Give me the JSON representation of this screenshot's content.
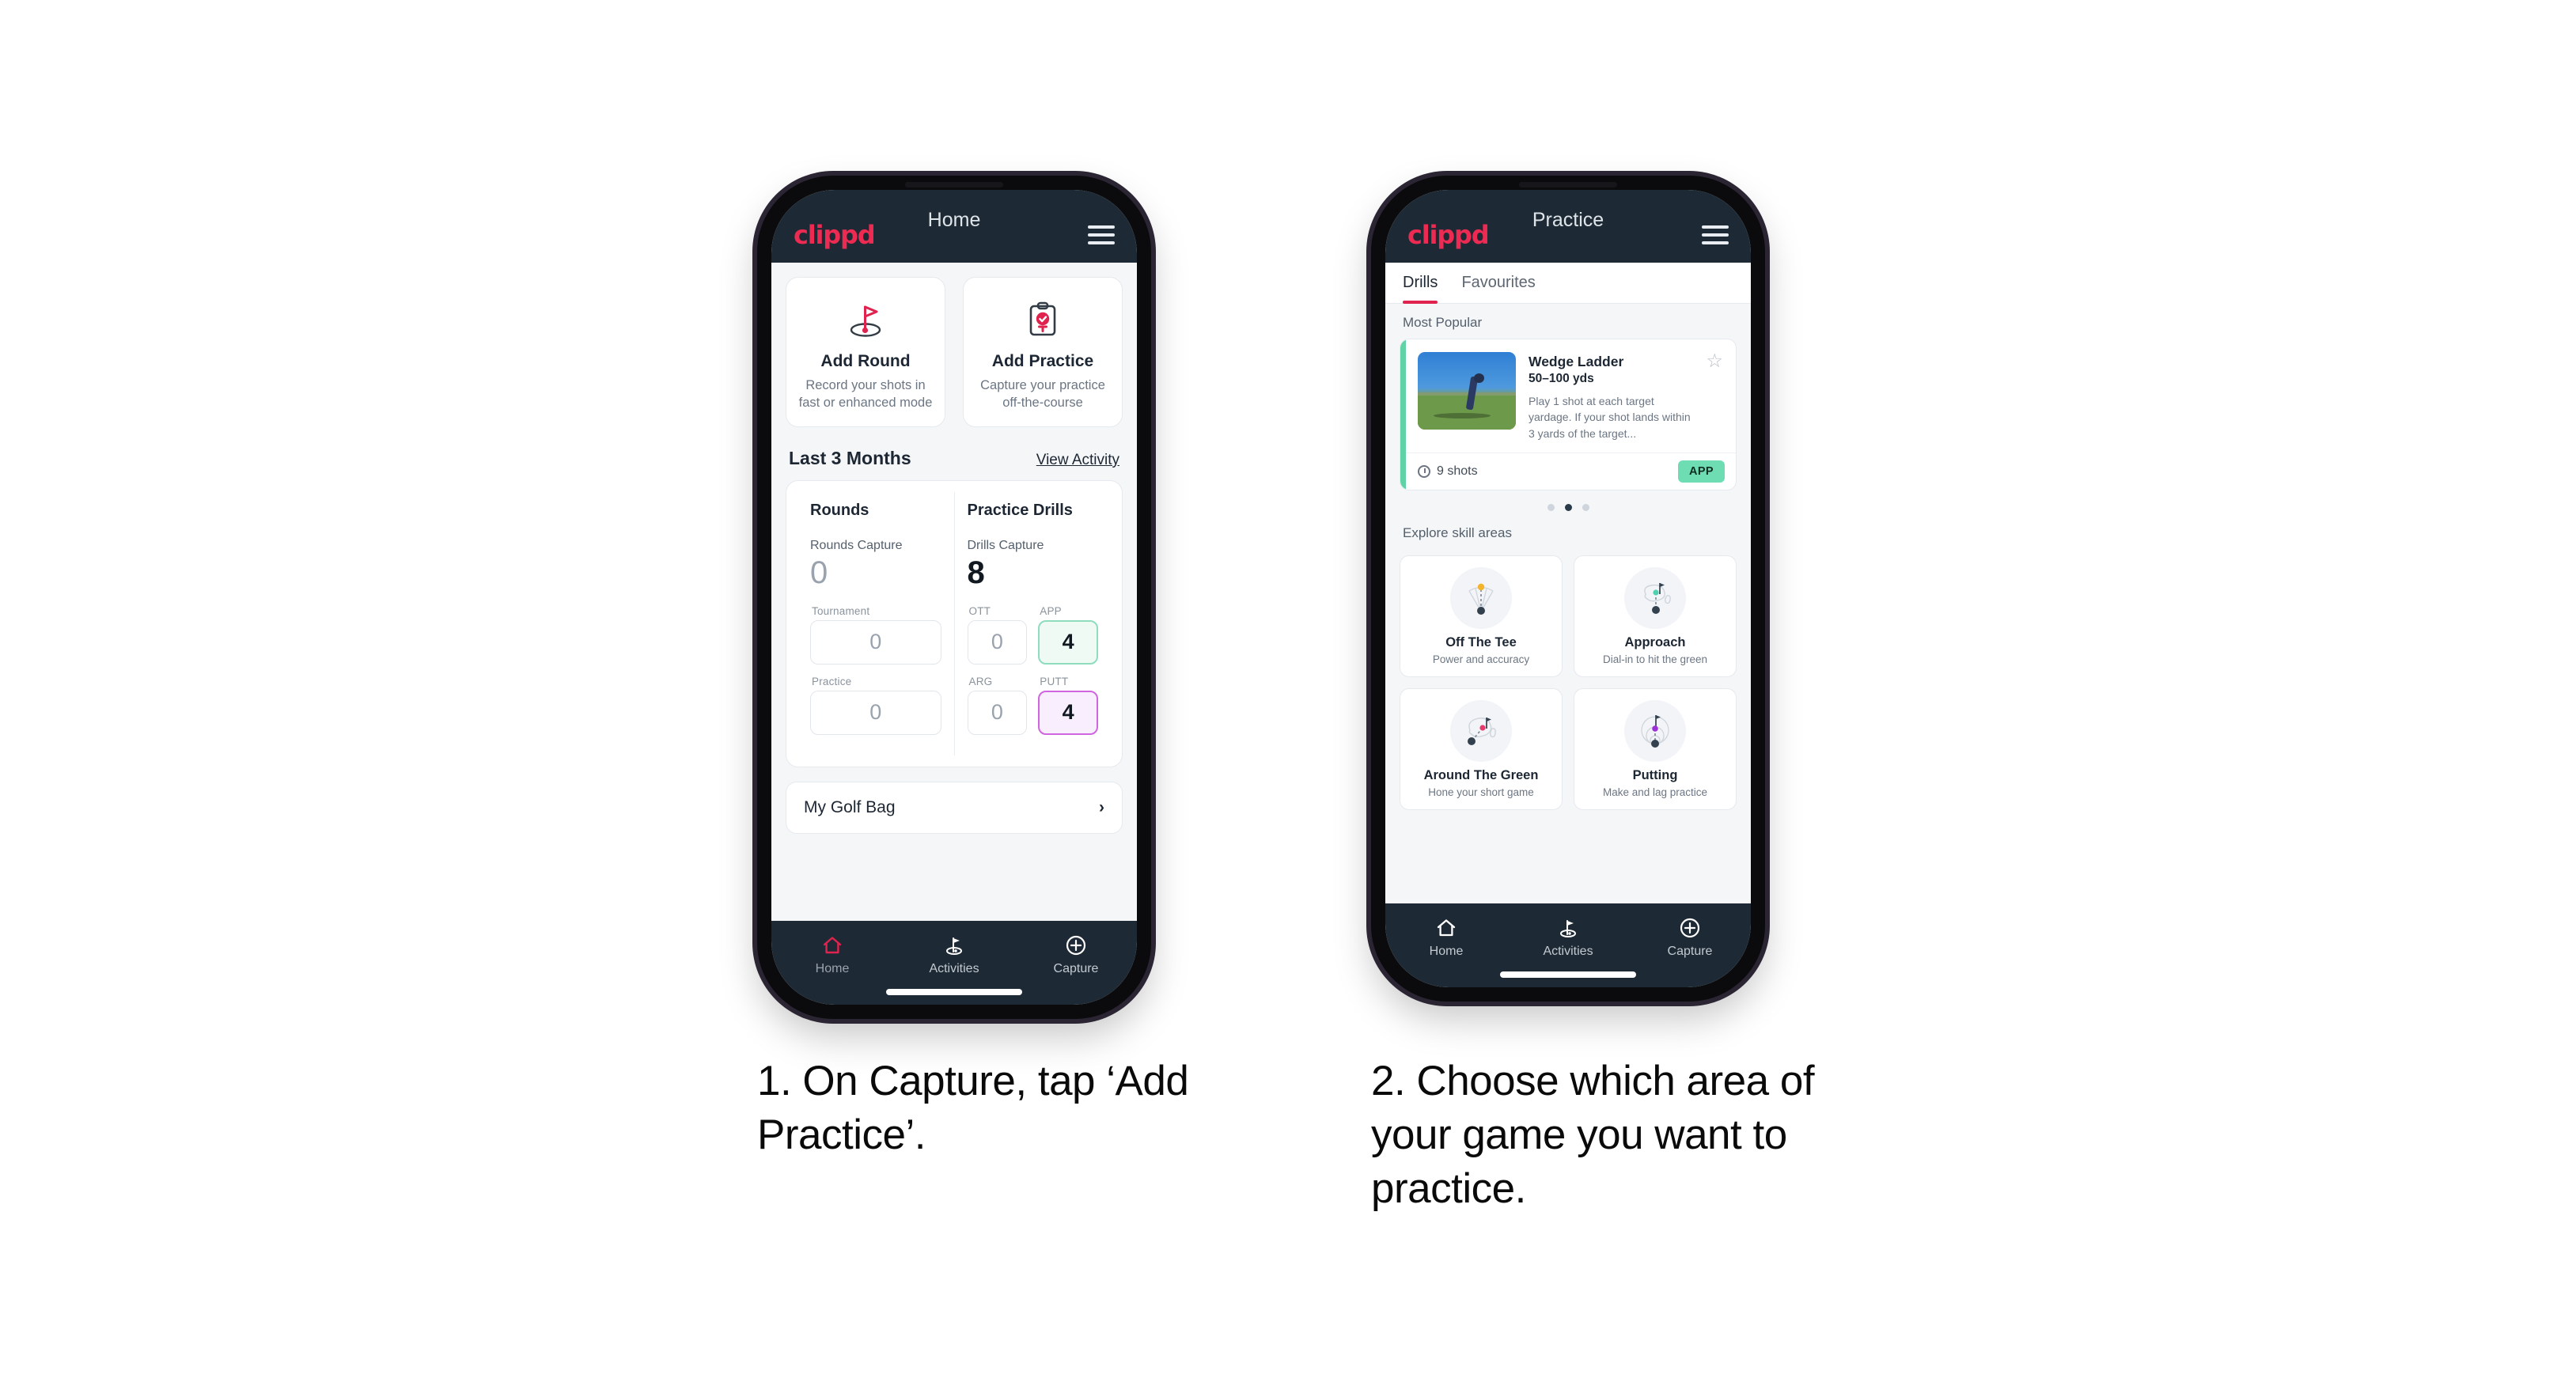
{
  "brand": {
    "name": "clippd",
    "color": "#ec2a52"
  },
  "phone1": {
    "header": {
      "title": "Home",
      "menu_icon": "hamburger-icon"
    },
    "actions": [
      {
        "icon": "golf-flag-hole-icon",
        "title": "Add Round",
        "desc": "Record your shots in fast or enhanced mode"
      },
      {
        "icon": "clipboard-check-tee-icon",
        "title": "Add Practice",
        "desc": "Capture your practice off-the-course"
      }
    ],
    "section": {
      "title": "Last 3 Months",
      "link": "View Activity"
    },
    "rounds": {
      "heading": "Rounds",
      "capture_label": "Rounds Capture",
      "capture_value": "0",
      "fields": [
        {
          "label": "Tournament",
          "value": "0",
          "state": "empty"
        },
        {
          "label": "Practice",
          "value": "0",
          "state": "empty"
        }
      ]
    },
    "drills": {
      "heading": "Practice Drills",
      "capture_label": "Drills Capture",
      "capture_value": "8",
      "fields": [
        {
          "label": "OTT",
          "value": "0",
          "state": "empty"
        },
        {
          "label": "APP",
          "value": "4",
          "state": "green"
        },
        {
          "label": "ARG",
          "value": "0",
          "state": "empty"
        },
        {
          "label": "PUTT",
          "value": "4",
          "state": "purple"
        }
      ]
    },
    "golf_bag": {
      "label": "My Golf Bag",
      "icon": "chevron-right-icon"
    },
    "nav": [
      {
        "icon": "home-icon",
        "label": "Home",
        "active": true
      },
      {
        "icon": "golf-flag-icon",
        "label": "Activities",
        "active": false
      },
      {
        "icon": "plus-circle-icon",
        "label": "Capture",
        "active": false
      }
    ]
  },
  "phone2": {
    "header": {
      "title": "Practice",
      "menu_icon": "hamburger-icon"
    },
    "tabs": [
      {
        "label": "Drills",
        "active": true
      },
      {
        "label": "Favourites",
        "active": false
      }
    ],
    "most_popular_label": "Most Popular",
    "drill_card": {
      "title": "Wedge Ladder",
      "yardage": "50–100 yds",
      "description": "Play 1 shot at each target yardage. If your shot lands within 3 yards of the target...",
      "shots": "9 shots",
      "badge": "APP",
      "badge_color": "#6fddb4",
      "accent_color": "#5fd3a6",
      "star_icon": "star-outline-icon",
      "clock_icon": "clock-icon",
      "thumbnail": "golfer-photo"
    },
    "carousel_dots": {
      "count": 3,
      "active_index": 1
    },
    "explore_label": "Explore skill areas",
    "skills": [
      {
        "icon": "tee-fan-icon",
        "title": "Off The Tee",
        "desc": "Power and accuracy",
        "dot_color": "#f4b32c"
      },
      {
        "icon": "green-approach-icon",
        "title": "Approach",
        "desc": "Dial-in to hit the green",
        "dot_color": "#4fd1b0"
      },
      {
        "icon": "chip-green-icon",
        "title": "Around The Green",
        "desc": "Hone your short game",
        "dot_color": "#e8396b"
      },
      {
        "icon": "putting-rings-icon",
        "title": "Putting",
        "desc": "Make and lag practice",
        "dot_color": "#9b30d9"
      }
    ],
    "nav": [
      {
        "icon": "home-icon",
        "label": "Home",
        "active": false
      },
      {
        "icon": "golf-flag-icon",
        "label": "Activities",
        "active": false
      },
      {
        "icon": "plus-circle-icon",
        "label": "Capture",
        "active": false
      }
    ]
  },
  "captions": {
    "one": "1. On Capture, tap ‘Add Practice’.",
    "two": "2. Choose which area of your game you want to practice."
  }
}
